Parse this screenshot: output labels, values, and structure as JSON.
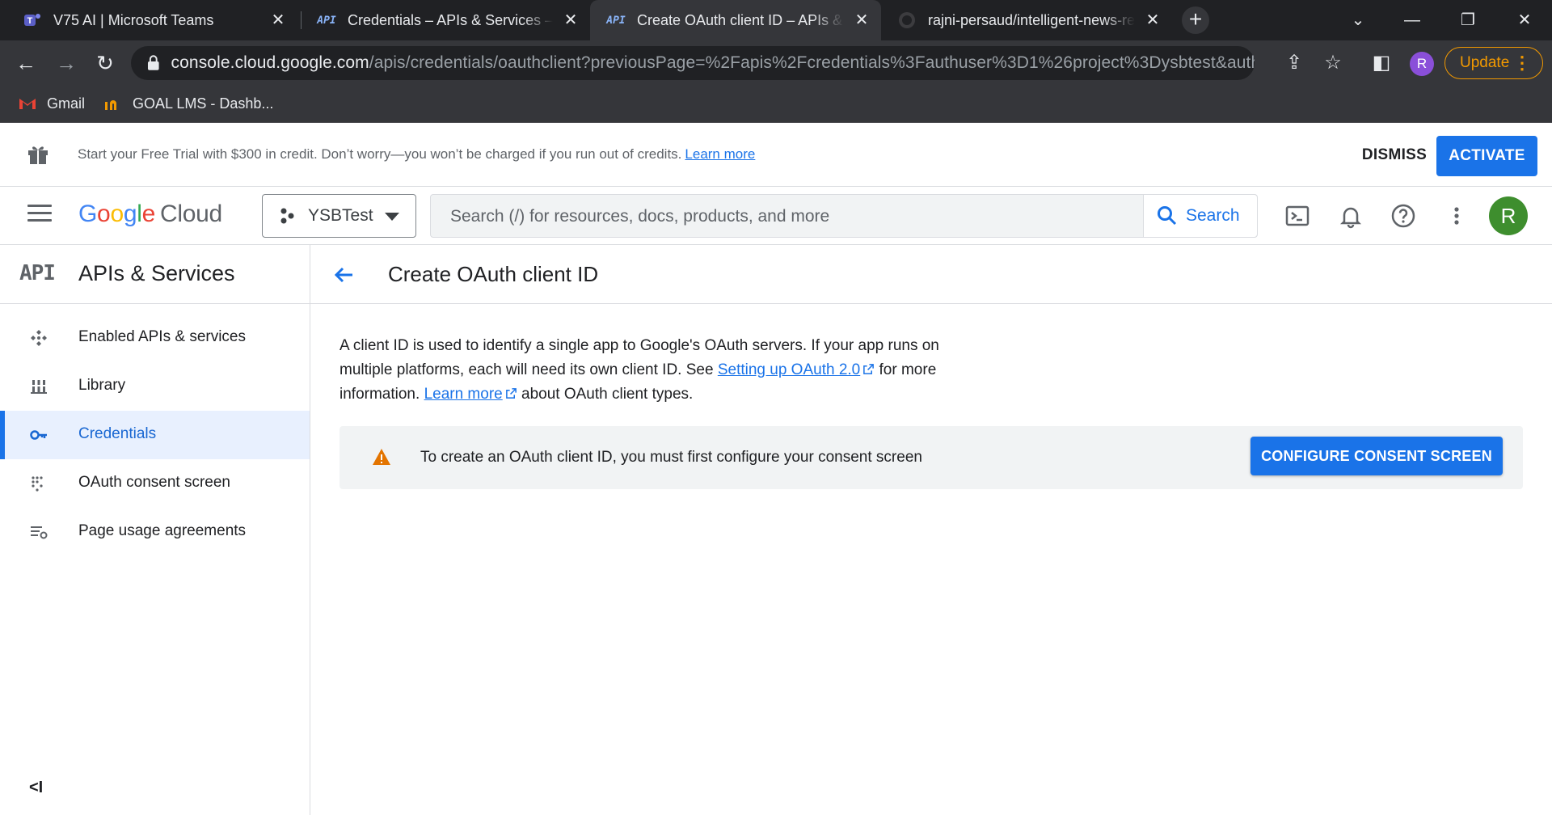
{
  "browser": {
    "tabs": [
      {
        "title": "V75 AI | Microsoft Teams",
        "icon": "teams-icon",
        "active": false
      },
      {
        "title": "Credentials – APIs & Services – M",
        "icon": "api-icon",
        "active": false
      },
      {
        "title": "Create OAuth client ID – APIs & S",
        "icon": "api-icon",
        "active": true
      },
      {
        "title": "rajni-persaud/intelligent-news-re",
        "icon": "github-icon",
        "active": false
      }
    ],
    "api_tab_glyph": "API",
    "url_host": "console.cloud.google.com",
    "url_path": "/apis/credentials/oauthclient?previousPage=%2Fapis%2Fcredentials%3Fauthuser%3D1%26project%3Dysbtest&authus...",
    "profile_initial": "R",
    "update_label": "Update",
    "bookmarks": [
      {
        "label": "Gmail",
        "icon": "gmail-icon"
      },
      {
        "label": "GOAL LMS - Dashb...",
        "icon": "goal-lms-icon"
      }
    ]
  },
  "banner": {
    "message": "Start your Free Trial with $300 in credit. Don’t worry—you won’t be charged if you run out of credits.",
    "learn_more": "Learn more",
    "dismiss": "DISMISS",
    "activate": "ACTIVATE"
  },
  "header": {
    "logo_letters": [
      "G",
      "o",
      "o",
      "g",
      "l",
      "e"
    ],
    "logo_product": "Cloud",
    "project": "YSBTest",
    "search_placeholder": "Search (/) for resources, docs, products, and more",
    "search_button": "Search",
    "avatar_initial": "R"
  },
  "sidebar": {
    "logo": "API",
    "title": "APIs & Services",
    "items": [
      {
        "label": "Enabled APIs & services",
        "icon": "enabled-apis-icon",
        "active": false
      },
      {
        "label": "Library",
        "icon": "library-icon",
        "active": false
      },
      {
        "label": "Credentials",
        "icon": "key-icon",
        "active": true
      },
      {
        "label": "OAuth consent screen",
        "icon": "consent-screen-icon",
        "active": false
      },
      {
        "label": "Page usage agreements",
        "icon": "settings-list-icon",
        "active": false
      }
    ],
    "collapse_glyph": "<I"
  },
  "main": {
    "title": "Create OAuth client ID",
    "intro_1": "A client ID is used to identify a single app to Google's OAuth servers. If your app runs on multiple platforms, each will need its own client ID. See",
    "setup_link": "Setting up OAuth 2.0",
    "intro_2": "for more information.",
    "learn_more": "Learn more",
    "intro_3": "about OAuth client types.",
    "notice": "To create an OAuth client ID, you must first configure your consent screen",
    "configure_button": "CONFIGURE CONSENT SCREEN"
  },
  "colors": {
    "primary": "#1a73e8",
    "warning": "#e37400",
    "update_accent": "#f29900",
    "avatar": "#3e8e2e"
  }
}
